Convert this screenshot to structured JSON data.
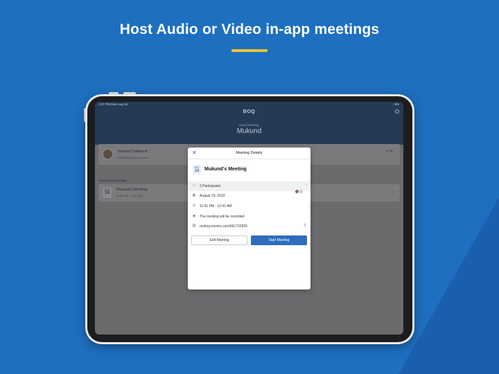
{
  "headline": "Host Audio or Video in-app meetings",
  "colors": {
    "background": "#1e6fc0",
    "accent_bar": "#f1c232",
    "primary_button": "#2e6dbd"
  },
  "status_bar": {
    "time": "2:37 PM",
    "date": "Mon Aug 19",
    "battery": "8%"
  },
  "app": {
    "logo": "BOQ",
    "greeting": "Good Evening,",
    "user_first_name": "Mukund",
    "user_icon": "user-circle-icon"
  },
  "profile": {
    "name": "Mukund Chillakanti",
    "email": "mchillakanti@yahoo.com"
  },
  "upcoming": {
    "section_title": "Upcoming Meetings",
    "items": [
      {
        "month": "AUG",
        "day": "19",
        "title": "Mukund's Meeting",
        "time": "11:41 PM - 12:41 AM"
      }
    ]
  },
  "modal": {
    "title": "Meeting Details",
    "close_icon": "close-icon",
    "meeting": {
      "month": "AUG",
      "day": "19",
      "title": "Mukund's Meeting"
    },
    "rows": {
      "participants": "2 Participants",
      "date": "August 19, 2019",
      "time": "11:41 PM - 12:41 AM",
      "recording": "The meeting will be recorded.",
      "link": "myboq.moxtra.com/661732826"
    },
    "icons": {
      "participants": "people-icon",
      "date": "calendar-icon",
      "time": "clock-icon",
      "recording": "record-icon",
      "link": "link-icon",
      "share": "share-icon"
    },
    "buttons": {
      "edit": "Edit Meeting",
      "start": "Start Meeting"
    }
  }
}
